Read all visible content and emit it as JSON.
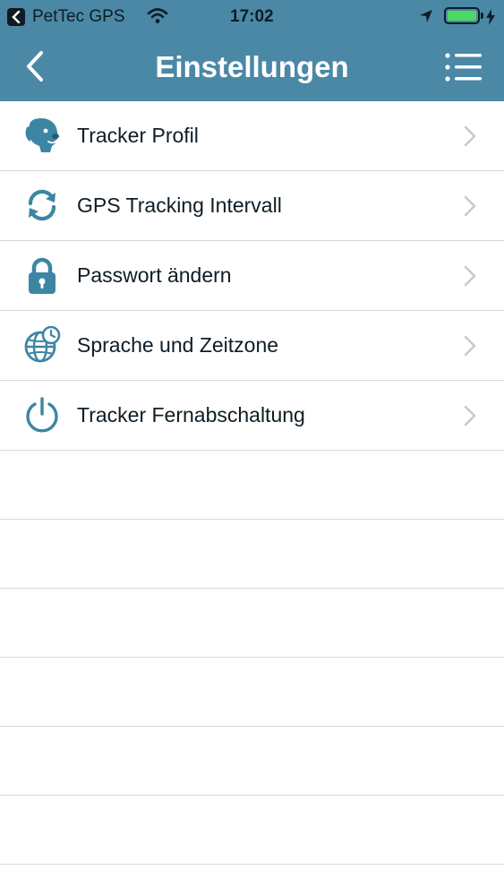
{
  "status_bar": {
    "carrier": "PetTec GPS",
    "time": "17:02",
    "battery_level": 1.0,
    "charging": true
  },
  "nav": {
    "title": "Einstellungen",
    "back_icon": "chevron-left-icon",
    "menu_icon": "list-menu-icon"
  },
  "settings": {
    "items": [
      {
        "label": "Tracker Profil",
        "icon": "dog-profile-icon"
      },
      {
        "label": "GPS Tracking Intervall",
        "icon": "refresh-icon"
      },
      {
        "label": "Passwort ändern",
        "icon": "lock-icon"
      },
      {
        "label": "Sprache und Zeitzone",
        "icon": "globe-clock-icon"
      },
      {
        "label": "Tracker Fernabschaltung",
        "icon": "power-icon"
      }
    ]
  },
  "colors": {
    "accent": "#4a88a6",
    "icon": "#3c86a3",
    "text": "#0f1c24",
    "divider": "#d9d9d9",
    "chevron": "#c7c7cc",
    "battery": "#4cd964"
  }
}
